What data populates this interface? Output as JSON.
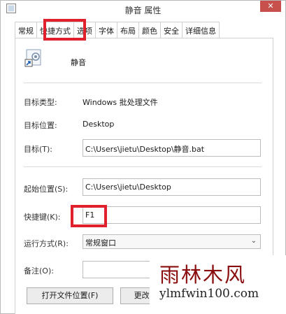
{
  "window": {
    "title": "静音 属性",
    "close_label": "✕"
  },
  "tabs": [
    "常规",
    "快捷方式",
    "选项",
    "字体",
    "布局",
    "颜色",
    "安全",
    "详细信息"
  ],
  "active_tab": "快捷方式",
  "shortcut": {
    "name": "静音"
  },
  "fields": {
    "target_type": {
      "label": "目标类型:",
      "value": "Windows 批处理文件"
    },
    "target_location": {
      "label": "目标位置:",
      "value": "Desktop"
    },
    "target": {
      "label": "目标(T):",
      "value": "C:\\Users\\jietu\\Desktop\\静音.bat"
    },
    "start_in": {
      "label": "起始位置(S):",
      "value": "C:\\Users\\jietu\\Desktop"
    },
    "shortcut_key": {
      "label": "快捷键(K):",
      "value": "F1"
    },
    "run": {
      "label": "运行方式(R):",
      "value": "常规窗口"
    },
    "comment": {
      "label": "备注(O):",
      "value": ""
    }
  },
  "buttons": {
    "open_location": "打开文件位置(F)",
    "change_icon": "更改图标(C)..."
  },
  "watermark": {
    "cn": "雨林木风",
    "en": "ylmfwin100.com"
  },
  "colors": {
    "highlight": "#e0202c",
    "watermark_cn": "#8a0d0d",
    "close": "#c7504c"
  }
}
